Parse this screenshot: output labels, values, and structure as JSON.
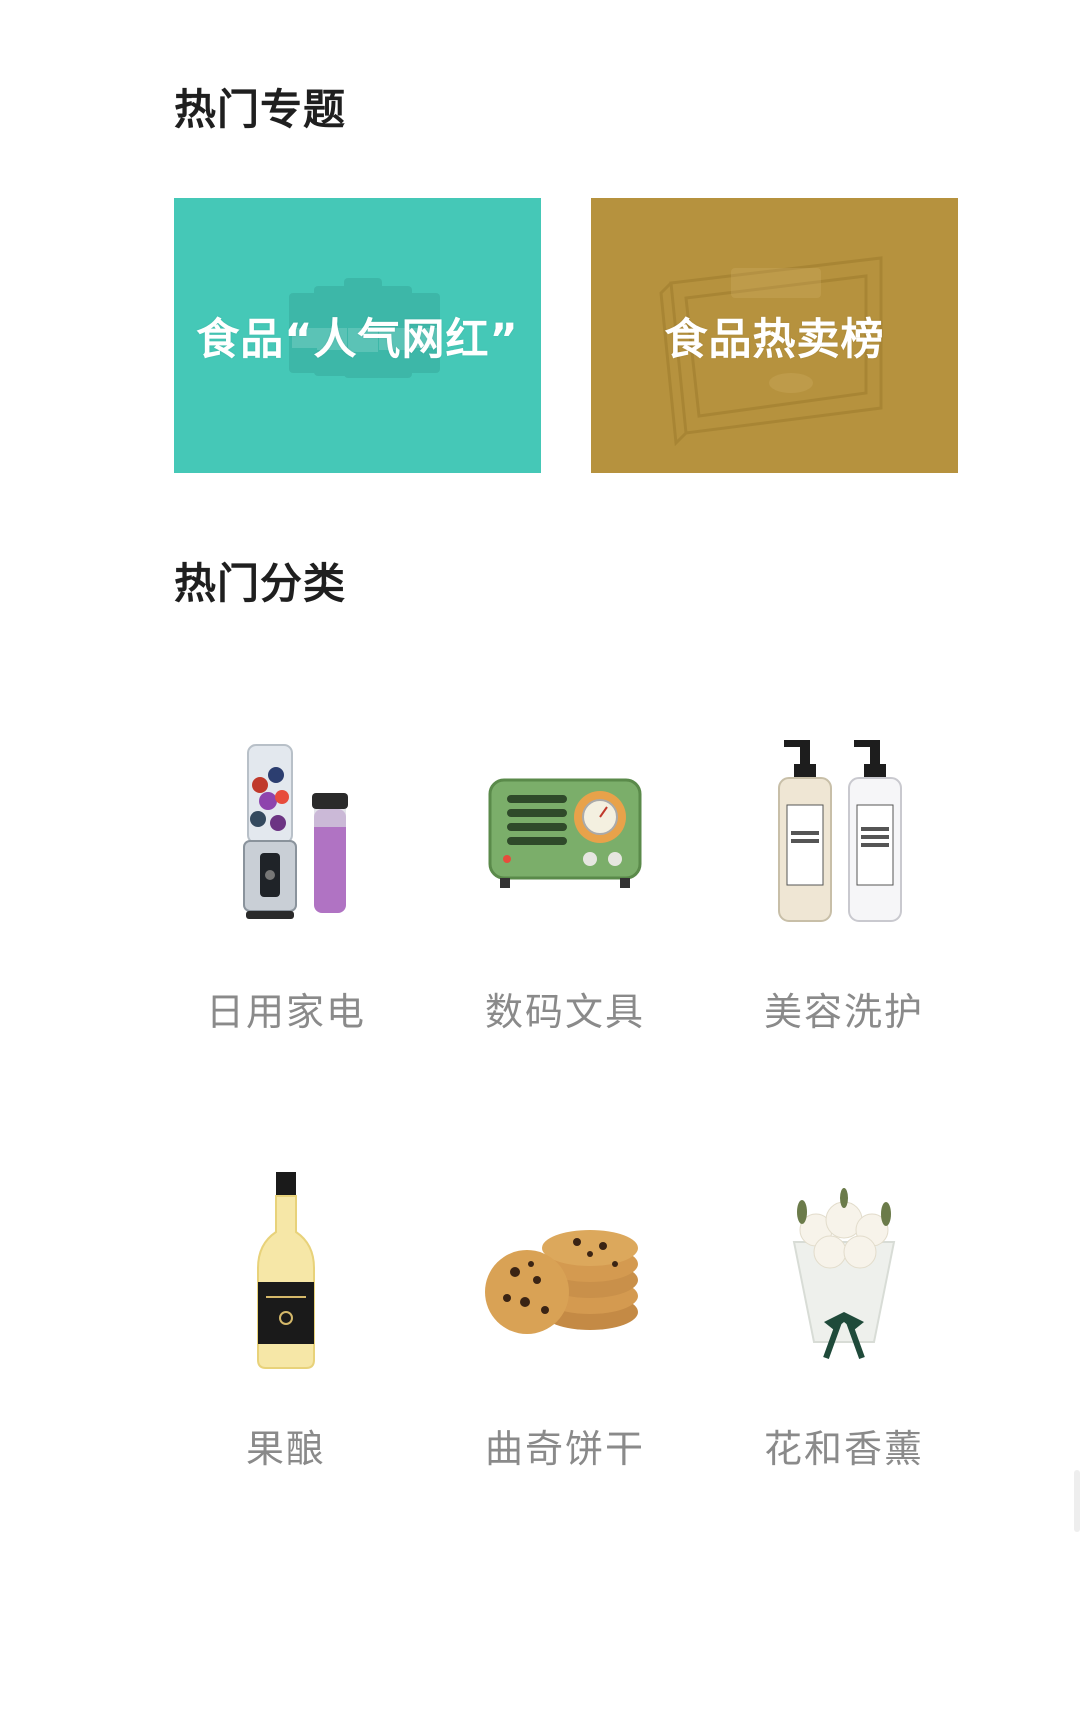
{
  "hot_topics": {
    "title": "热门专题",
    "cards": [
      {
        "label": "食品“人气网红”",
        "bg_color": "#45c8b7"
      },
      {
        "label": "食品热卖榜",
        "bg_color": "#b6923e"
      }
    ]
  },
  "hot_categories": {
    "title": "热门分类",
    "items": [
      {
        "label": "日用家电",
        "icon": "blender-icon"
      },
      {
        "label": "数码文具",
        "icon": "radio-icon"
      },
      {
        "label": "美容洗护",
        "icon": "soap-bottles-icon"
      },
      {
        "label": "果酿",
        "icon": "wine-bottle-icon"
      },
      {
        "label": "曲奇饼干",
        "icon": "cookies-icon"
      },
      {
        "label": "花和香薰",
        "icon": "flower-bouquet-icon"
      }
    ]
  },
  "colors": {
    "title_text": "#1f1f1f",
    "category_text": "#8a8a8a"
  }
}
